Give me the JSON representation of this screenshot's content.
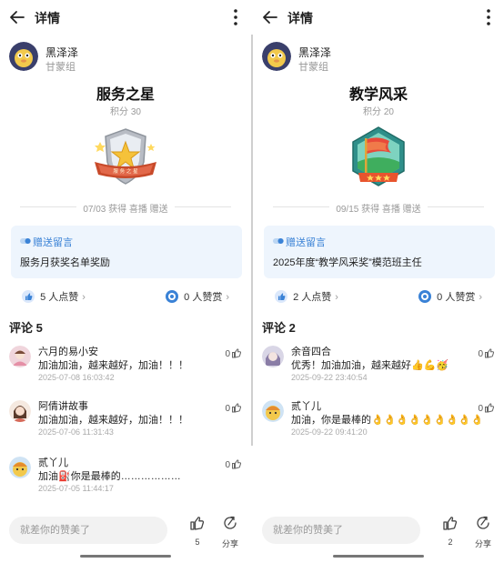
{
  "colors": {
    "accent_blue": "#3a82d6",
    "gift_bg": "#eef5fd",
    "muted": "#999999"
  },
  "panels": [
    {
      "header": {
        "title": "详情"
      },
      "author": {
        "name": "黑泽泽",
        "group": "甘蒙组"
      },
      "honor": {
        "title": "服务之星",
        "points": "积分 30",
        "badge_text": "服 务 之 星",
        "badge_icon": "star-shield-badge"
      },
      "meta": {
        "text": "07/03 获得 喜播 赠送"
      },
      "gift": {
        "label": "赠送留言",
        "message": "服务月获奖名单奖励"
      },
      "likes": {
        "text": "5 人点赞"
      },
      "rewards": {
        "text": "0 人赞赏"
      },
      "comments_title": "评论 5",
      "comments": [
        {
          "name": "六月的易小安",
          "text": "加油加油，越来越好，加油！！！",
          "time": "2025-07-08 16:03:42",
          "likes": "0"
        },
        {
          "name": "阿倩讲故事",
          "text": "加油加油，越来越好，加油！！！",
          "time": "2025-07-06 11:31:43",
          "likes": "0"
        },
        {
          "name": "贰丫儿",
          "text": "加油⛽你是最棒的………………",
          "time": "2025-07-05 11:44:17",
          "likes": "0"
        }
      ],
      "bottom": {
        "placeholder": "就差你的赞美了",
        "like_count": "5",
        "share_label": "分享"
      }
    },
    {
      "header": {
        "title": "详情"
      },
      "author": {
        "name": "黑泽泽",
        "group": "甘蒙组"
      },
      "honor": {
        "title": "教学风采",
        "points": "积分 20",
        "badge_icon": "flag-hexagon-badge"
      },
      "meta": {
        "text": "09/15 获得 喜播 赠送"
      },
      "gift": {
        "label": "赠送留言",
        "message": "2025年度“教学风采奖”模范班主任"
      },
      "likes": {
        "text": "2 人点赞"
      },
      "rewards": {
        "text": "0 人赞赏"
      },
      "comments_title": "评论 2",
      "comments": [
        {
          "name": "余音四合",
          "text": "优秀！加油加油，越来越好👍💪🥳",
          "time": "2025-09-22 23:40:54",
          "likes": "0"
        },
        {
          "name": "贰丫儿",
          "text": "加油，你是最棒的👌👌👌👌👌👌👌👌👌",
          "time": "2025-09-22 09:41:20",
          "likes": "0"
        }
      ],
      "bottom": {
        "placeholder": "就差你的赞美了",
        "like_count": "2",
        "share_label": "分享"
      }
    }
  ]
}
